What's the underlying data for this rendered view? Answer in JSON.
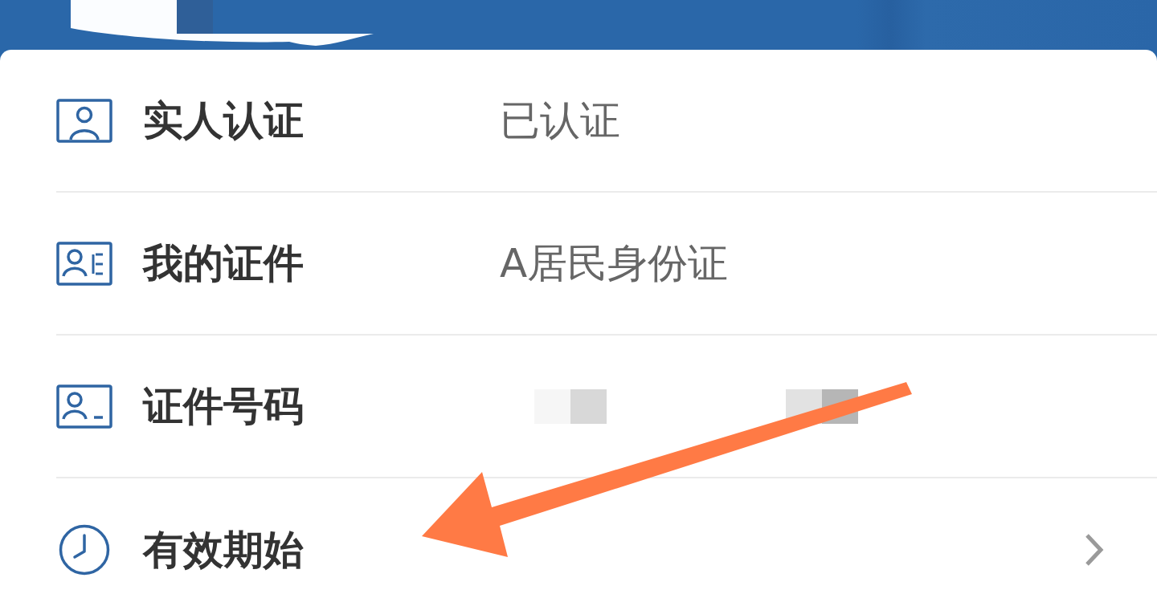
{
  "rows": [
    {
      "kind": "text",
      "label": "实人认证",
      "value": "已认证"
    },
    {
      "kind": "text",
      "label": "我的证件",
      "value": "A居民身份证"
    },
    {
      "kind": "redacted",
      "label": "证件号码"
    },
    {
      "kind": "link",
      "label": "有效期始"
    }
  ],
  "annotation": {
    "kind": "arrow"
  }
}
